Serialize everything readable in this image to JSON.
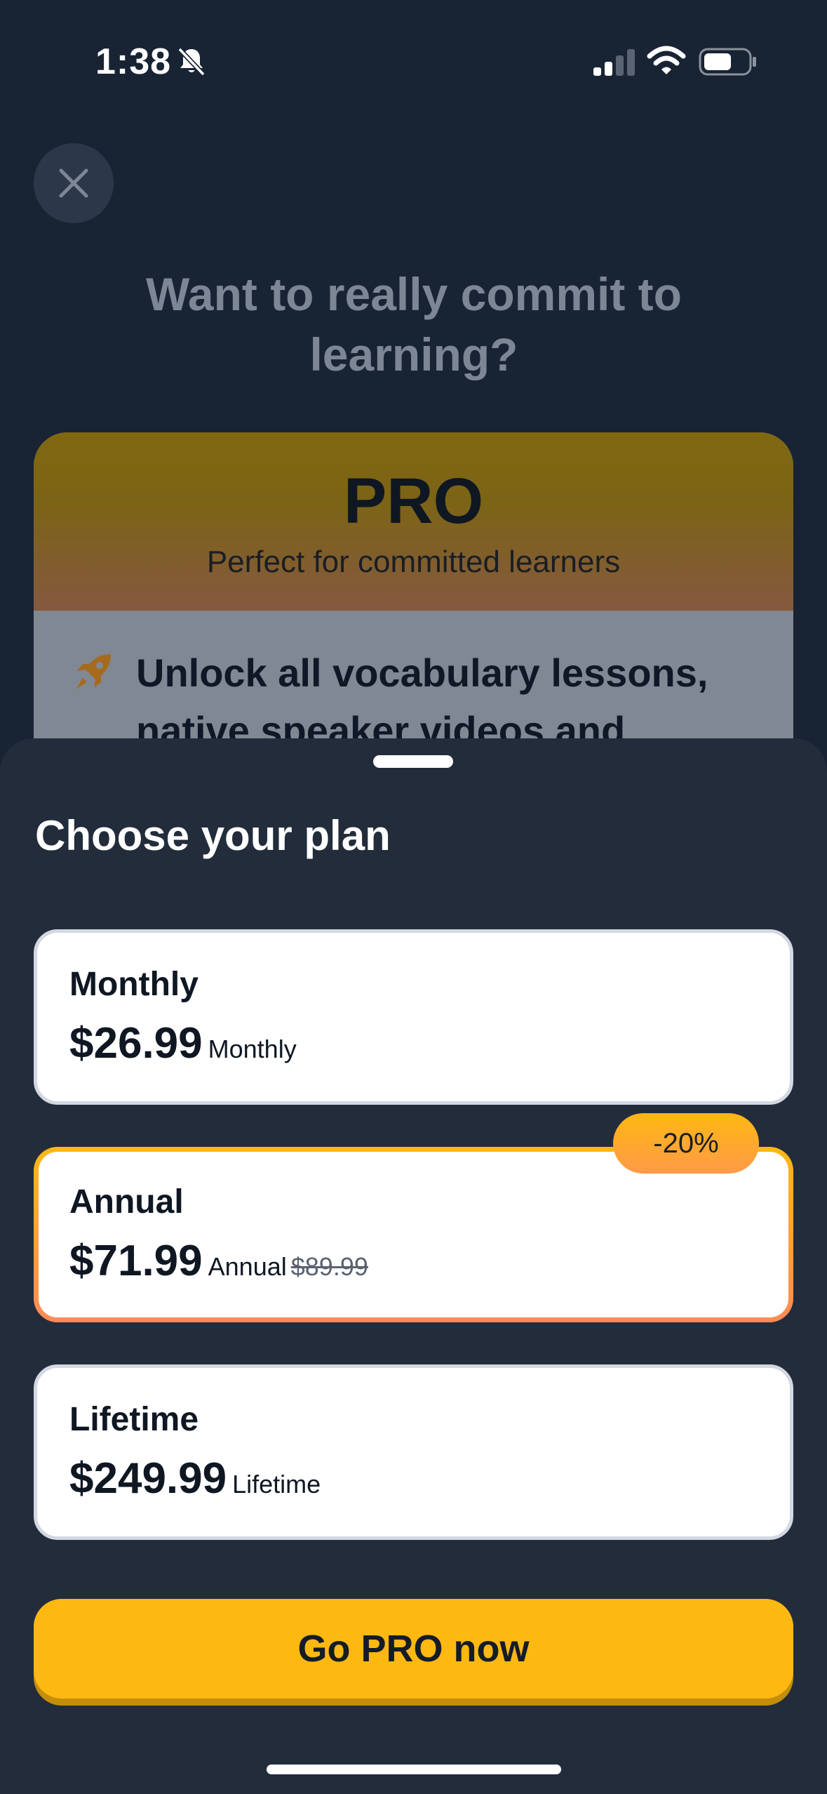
{
  "status_bar": {
    "time": "1:38"
  },
  "background": {
    "headline": "Want to really commit to learning?",
    "pro_card": {
      "title": "PRO",
      "subtitle": "Perfect for committed learners",
      "feature": "Unlock all vocabulary lessons, native speaker videos and"
    }
  },
  "sheet": {
    "title": "Choose your plan",
    "plans": [
      {
        "name": "Monthly",
        "price": "$26.99",
        "period": "Monthly",
        "selected": false
      },
      {
        "name": "Annual",
        "price": "$71.99",
        "period": "Annual",
        "old_price": "$89.99",
        "badge": "-20%",
        "selected": true
      },
      {
        "name": "Lifetime",
        "price": "$249.99",
        "period": "Lifetime",
        "selected": false
      }
    ],
    "cta_label": "Go PRO now"
  },
  "colors": {
    "accent": "#fdb812",
    "accent_secondary": "#ff8a56",
    "sheet_background": "#222c3b",
    "screen_background": "#182334"
  },
  "icons": [
    "bell-slash-icon",
    "signal-icon",
    "wifi-icon",
    "battery-icon",
    "close-icon",
    "rocket-icon"
  ]
}
